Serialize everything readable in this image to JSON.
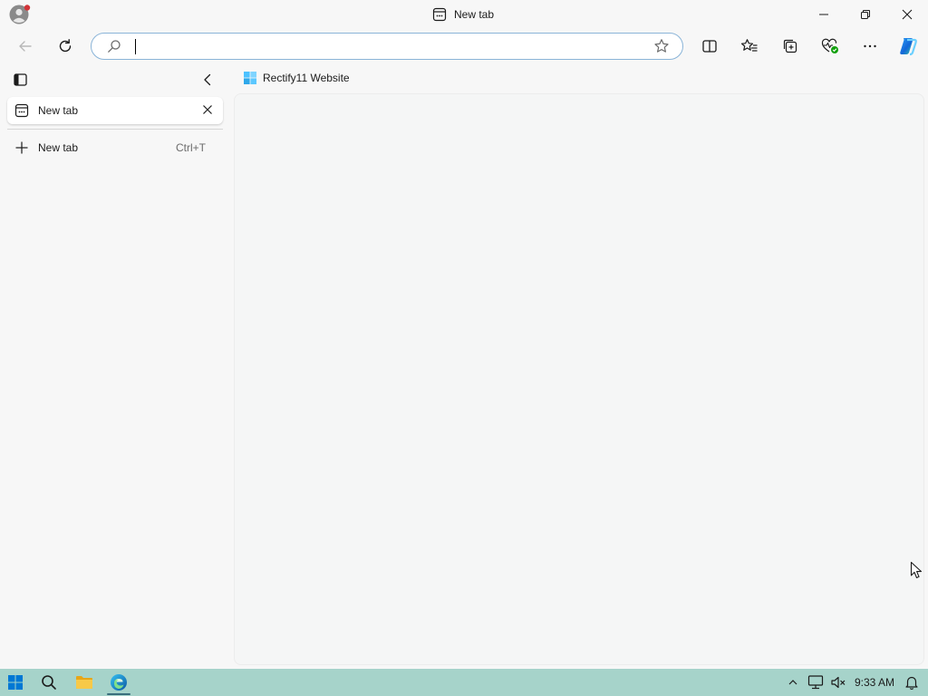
{
  "window": {
    "title": "New tab"
  },
  "toolbar": {
    "address_value": "",
    "address_placeholder": ""
  },
  "sidebar": {
    "tabs": [
      {
        "label": "New tab"
      }
    ],
    "new_tab_label": "New tab",
    "new_tab_shortcut": "Ctrl+T"
  },
  "favorites_bar": {
    "items": [
      {
        "label": "Rectify11 Website"
      }
    ]
  },
  "taskbar": {
    "time": "9:33 AM"
  },
  "colors": {
    "accent": "#0f6cbd",
    "taskbar": "#a6d3ca",
    "profile_badge": "#d13438",
    "health_badge": "#13a10e"
  }
}
